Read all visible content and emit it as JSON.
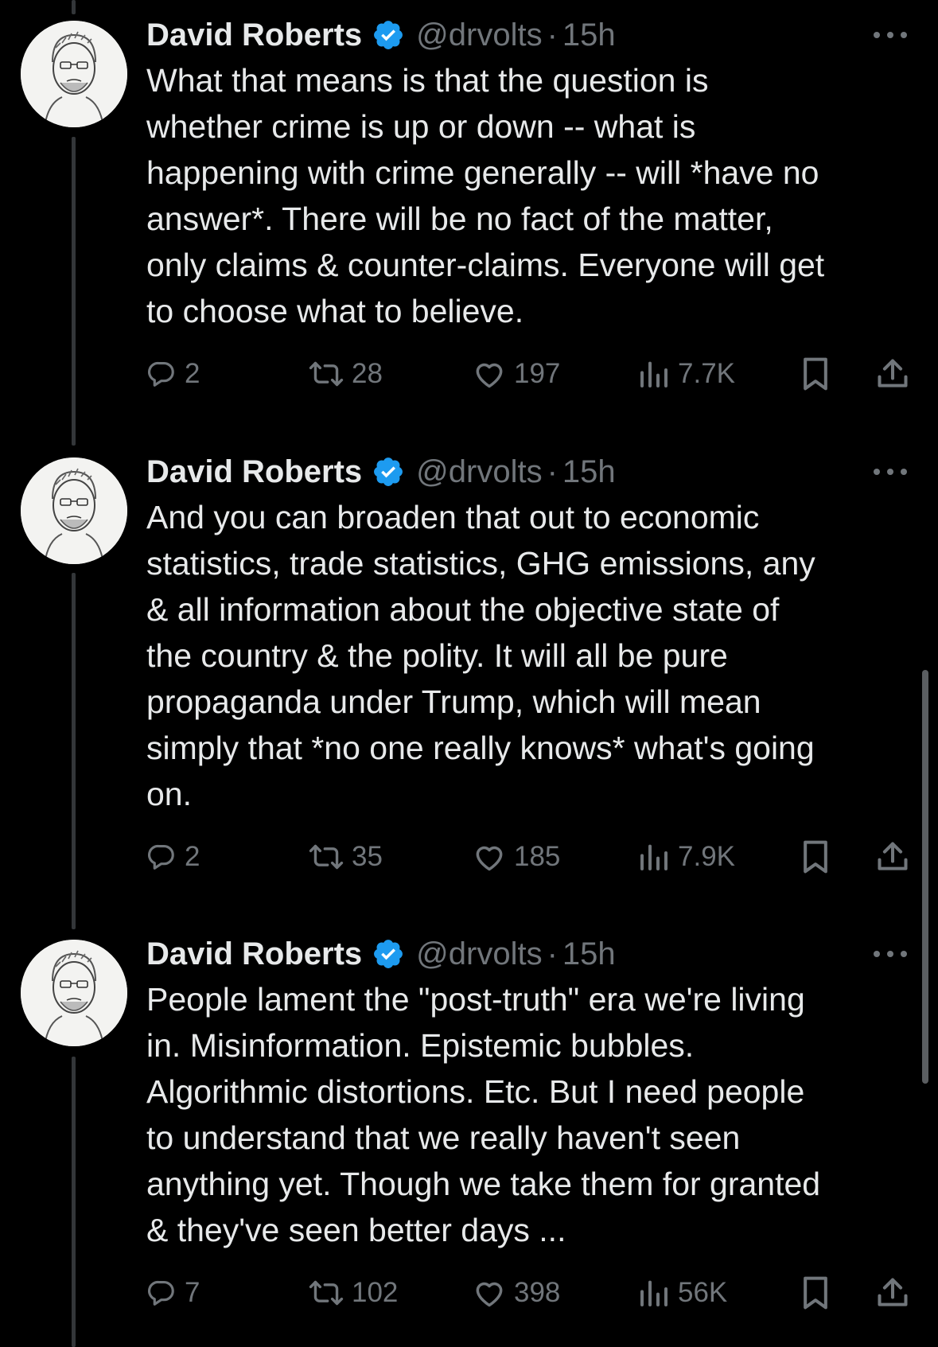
{
  "author": {
    "name": "David Roberts",
    "handle": "@drvolts",
    "dot": "·",
    "verified_color": "#1d9bf0"
  },
  "icons": {
    "verified": "verified-badge-icon",
    "more": "more-options-icon",
    "reply": "reply-icon",
    "repost": "repost-icon",
    "like": "like-icon",
    "views": "views-icon",
    "bookmark": "bookmark-icon",
    "share": "share-icon"
  },
  "tweets": [
    {
      "time": "15h",
      "text": "What that means is that the question is\nwhether crime is up or down -- what is\nhappening with crime generally -- will *have no\nanswer*. There will be no fact of the matter,\nonly claims & counter-claims. Everyone will get\nto choose what to believe.",
      "replies": "2",
      "reposts": "28",
      "likes": "197",
      "views": "7.7K"
    },
    {
      "time": "15h",
      "text": "And you can broaden that out to economic\nstatistics, trade statistics, GHG emissions, any\n& all information about the objective state of\nthe country & the polity. It will all be pure\npropaganda under Trump, which will mean\nsimply that *no one really knows* what's going\non.",
      "replies": "2",
      "reposts": "35",
      "likes": "185",
      "views": "7.9K"
    },
    {
      "time": "15h",
      "text": "People lament the \"post-truth\" era we're living\nin. Misinformation. Epistemic bubbles.\nAlgorithmic distortions. Etc. But I need people\nto understand that we really haven't seen\nanything yet. Though we take them for granted\n& they've seen better days ...",
      "replies": "7",
      "reposts": "102",
      "likes": "398",
      "views": "56K"
    }
  ]
}
